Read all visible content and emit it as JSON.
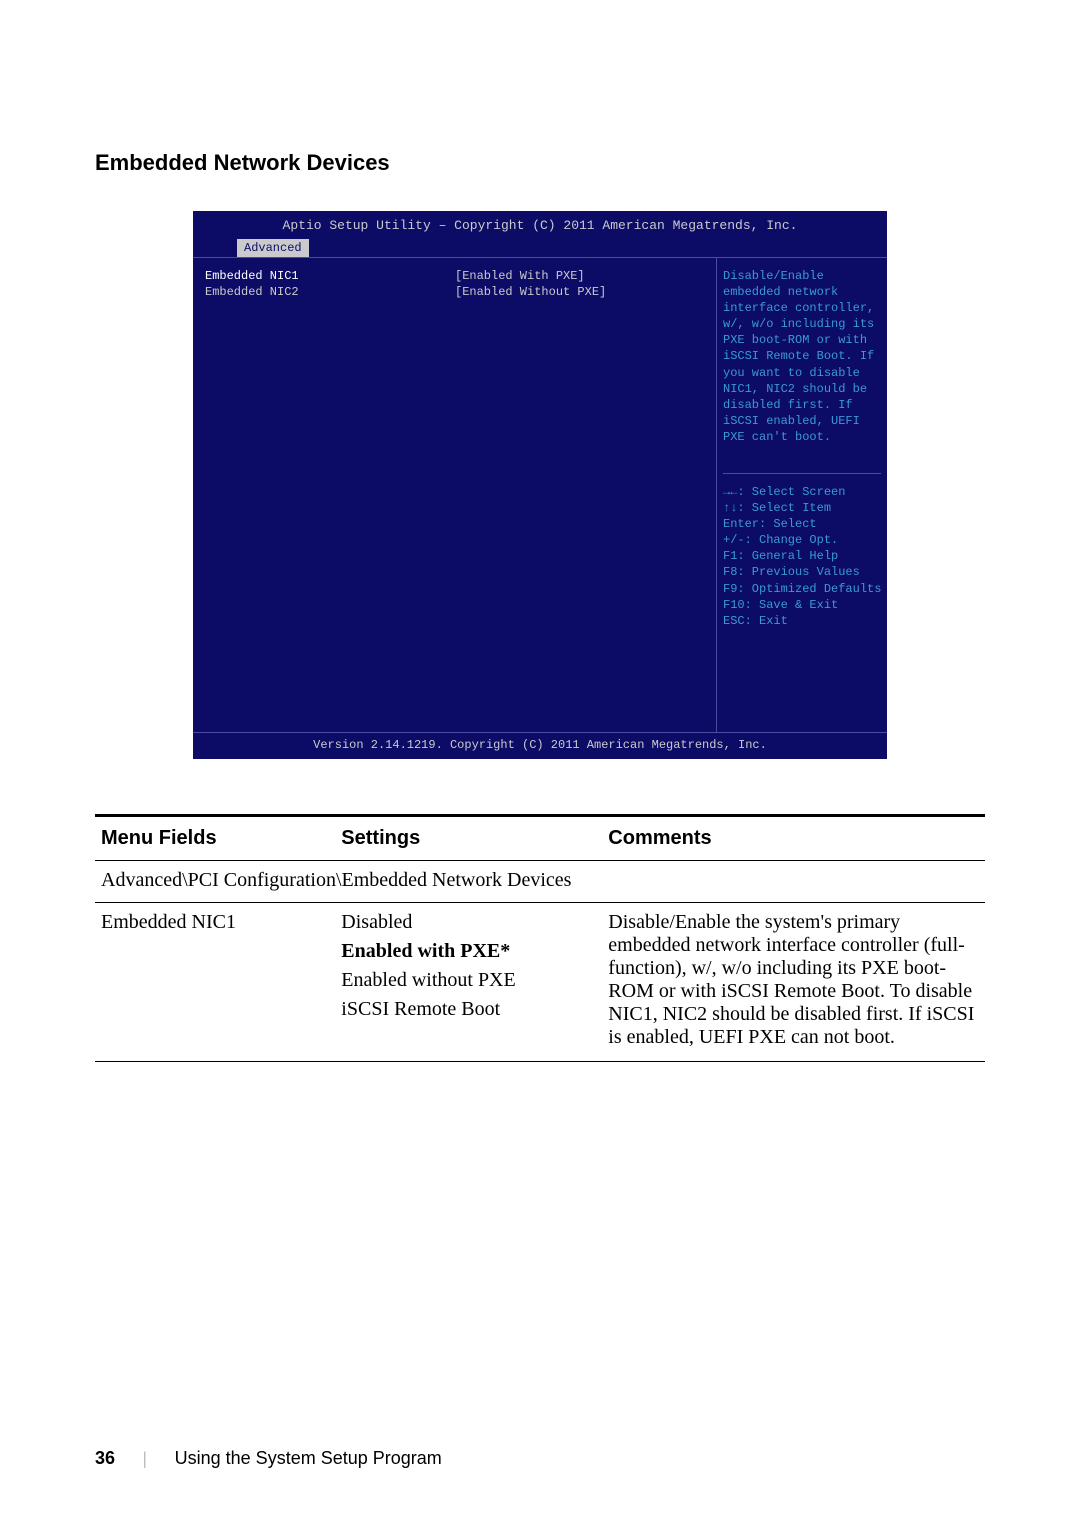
{
  "heading": "Embedded Network Devices",
  "bios": {
    "header": "Aptio Setup Utility – Copyright (C) 2011 American Megatrends, Inc.",
    "tab": "Advanced",
    "rows": [
      {
        "label": "Embedded NIC1",
        "value": "[Enabled With PXE]",
        "highlight": true
      },
      {
        "label": "Embedded NIC2",
        "value": "[Enabled Without PXE]",
        "highlight": false
      }
    ],
    "help": "Disable/Enable embedded network interface controller, w/, w/o including its PXE boot-ROM or with iSCSI Remote Boot. If you want to disable NIC1, NIC2 should be disabled first. If iSCSI enabled, UEFI PXE can't boot.",
    "keys": [
      "→←: Select Screen",
      "↑↓: Select Item",
      "Enter: Select",
      "+/-: Change Opt.",
      "F1: General Help",
      "F8: Previous Values",
      "F9: Optimized Defaults",
      "F10: Save & Exit",
      "ESC: Exit"
    ],
    "footer": "Version 2.14.1219. Copyright (C) 2011 American Megatrends, Inc."
  },
  "table": {
    "headers": {
      "menu": "Menu Fields",
      "settings": "Settings",
      "comments": "Comments"
    },
    "path": "Advanced\\PCI Configuration\\Embedded Network Devices",
    "row": {
      "menu": "Embedded NIC1",
      "settings": [
        {
          "text": "Disabled",
          "bold": false
        },
        {
          "text": "Enabled with PXE*",
          "bold": true
        },
        {
          "text": "Enabled without PXE",
          "bold": false
        },
        {
          "text": "iSCSI Remote Boot",
          "bold": false
        }
      ],
      "comments": "Disable/Enable the system's primary embedded network interface controller (full-function), w/, w/o including its PXE boot-ROM or with iSCSI Remote Boot. To disable NIC1, NIC2 should be disabled first. If iSCSI is enabled, UEFI PXE can not boot."
    }
  },
  "footer": {
    "page": "36",
    "text": "Using the System Setup Program"
  }
}
